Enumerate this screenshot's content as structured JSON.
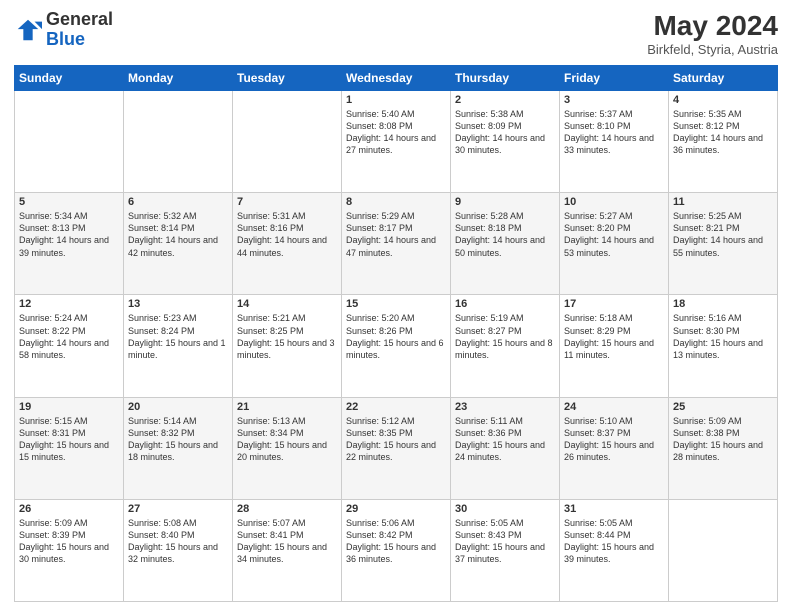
{
  "header": {
    "logo_general": "General",
    "logo_blue": "Blue",
    "month_year": "May 2024",
    "location": "Birkfeld, Styria, Austria"
  },
  "days_of_week": [
    "Sunday",
    "Monday",
    "Tuesday",
    "Wednesday",
    "Thursday",
    "Friday",
    "Saturday"
  ],
  "weeks": [
    [
      {
        "day": "",
        "sunrise": "",
        "sunset": "",
        "daylight": ""
      },
      {
        "day": "",
        "sunrise": "",
        "sunset": "",
        "daylight": ""
      },
      {
        "day": "",
        "sunrise": "",
        "sunset": "",
        "daylight": ""
      },
      {
        "day": "1",
        "sunrise": "Sunrise: 5:40 AM",
        "sunset": "Sunset: 8:08 PM",
        "daylight": "Daylight: 14 hours and 27 minutes."
      },
      {
        "day": "2",
        "sunrise": "Sunrise: 5:38 AM",
        "sunset": "Sunset: 8:09 PM",
        "daylight": "Daylight: 14 hours and 30 minutes."
      },
      {
        "day": "3",
        "sunrise": "Sunrise: 5:37 AM",
        "sunset": "Sunset: 8:10 PM",
        "daylight": "Daylight: 14 hours and 33 minutes."
      },
      {
        "day": "4",
        "sunrise": "Sunrise: 5:35 AM",
        "sunset": "Sunset: 8:12 PM",
        "daylight": "Daylight: 14 hours and 36 minutes."
      }
    ],
    [
      {
        "day": "5",
        "sunrise": "Sunrise: 5:34 AM",
        "sunset": "Sunset: 8:13 PM",
        "daylight": "Daylight: 14 hours and 39 minutes."
      },
      {
        "day": "6",
        "sunrise": "Sunrise: 5:32 AM",
        "sunset": "Sunset: 8:14 PM",
        "daylight": "Daylight: 14 hours and 42 minutes."
      },
      {
        "day": "7",
        "sunrise": "Sunrise: 5:31 AM",
        "sunset": "Sunset: 8:16 PM",
        "daylight": "Daylight: 14 hours and 44 minutes."
      },
      {
        "day": "8",
        "sunrise": "Sunrise: 5:29 AM",
        "sunset": "Sunset: 8:17 PM",
        "daylight": "Daylight: 14 hours and 47 minutes."
      },
      {
        "day": "9",
        "sunrise": "Sunrise: 5:28 AM",
        "sunset": "Sunset: 8:18 PM",
        "daylight": "Daylight: 14 hours and 50 minutes."
      },
      {
        "day": "10",
        "sunrise": "Sunrise: 5:27 AM",
        "sunset": "Sunset: 8:20 PM",
        "daylight": "Daylight: 14 hours and 53 minutes."
      },
      {
        "day": "11",
        "sunrise": "Sunrise: 5:25 AM",
        "sunset": "Sunset: 8:21 PM",
        "daylight": "Daylight: 14 hours and 55 minutes."
      }
    ],
    [
      {
        "day": "12",
        "sunrise": "Sunrise: 5:24 AM",
        "sunset": "Sunset: 8:22 PM",
        "daylight": "Daylight: 14 hours and 58 minutes."
      },
      {
        "day": "13",
        "sunrise": "Sunrise: 5:23 AM",
        "sunset": "Sunset: 8:24 PM",
        "daylight": "Daylight: 15 hours and 1 minute."
      },
      {
        "day": "14",
        "sunrise": "Sunrise: 5:21 AM",
        "sunset": "Sunset: 8:25 PM",
        "daylight": "Daylight: 15 hours and 3 minutes."
      },
      {
        "day": "15",
        "sunrise": "Sunrise: 5:20 AM",
        "sunset": "Sunset: 8:26 PM",
        "daylight": "Daylight: 15 hours and 6 minutes."
      },
      {
        "day": "16",
        "sunrise": "Sunrise: 5:19 AM",
        "sunset": "Sunset: 8:27 PM",
        "daylight": "Daylight: 15 hours and 8 minutes."
      },
      {
        "day": "17",
        "sunrise": "Sunrise: 5:18 AM",
        "sunset": "Sunset: 8:29 PM",
        "daylight": "Daylight: 15 hours and 11 minutes."
      },
      {
        "day": "18",
        "sunrise": "Sunrise: 5:16 AM",
        "sunset": "Sunset: 8:30 PM",
        "daylight": "Daylight: 15 hours and 13 minutes."
      }
    ],
    [
      {
        "day": "19",
        "sunrise": "Sunrise: 5:15 AM",
        "sunset": "Sunset: 8:31 PM",
        "daylight": "Daylight: 15 hours and 15 minutes."
      },
      {
        "day": "20",
        "sunrise": "Sunrise: 5:14 AM",
        "sunset": "Sunset: 8:32 PM",
        "daylight": "Daylight: 15 hours and 18 minutes."
      },
      {
        "day": "21",
        "sunrise": "Sunrise: 5:13 AM",
        "sunset": "Sunset: 8:34 PM",
        "daylight": "Daylight: 15 hours and 20 minutes."
      },
      {
        "day": "22",
        "sunrise": "Sunrise: 5:12 AM",
        "sunset": "Sunset: 8:35 PM",
        "daylight": "Daylight: 15 hours and 22 minutes."
      },
      {
        "day": "23",
        "sunrise": "Sunrise: 5:11 AM",
        "sunset": "Sunset: 8:36 PM",
        "daylight": "Daylight: 15 hours and 24 minutes."
      },
      {
        "day": "24",
        "sunrise": "Sunrise: 5:10 AM",
        "sunset": "Sunset: 8:37 PM",
        "daylight": "Daylight: 15 hours and 26 minutes."
      },
      {
        "day": "25",
        "sunrise": "Sunrise: 5:09 AM",
        "sunset": "Sunset: 8:38 PM",
        "daylight": "Daylight: 15 hours and 28 minutes."
      }
    ],
    [
      {
        "day": "26",
        "sunrise": "Sunrise: 5:09 AM",
        "sunset": "Sunset: 8:39 PM",
        "daylight": "Daylight: 15 hours and 30 minutes."
      },
      {
        "day": "27",
        "sunrise": "Sunrise: 5:08 AM",
        "sunset": "Sunset: 8:40 PM",
        "daylight": "Daylight: 15 hours and 32 minutes."
      },
      {
        "day": "28",
        "sunrise": "Sunrise: 5:07 AM",
        "sunset": "Sunset: 8:41 PM",
        "daylight": "Daylight: 15 hours and 34 minutes."
      },
      {
        "day": "29",
        "sunrise": "Sunrise: 5:06 AM",
        "sunset": "Sunset: 8:42 PM",
        "daylight": "Daylight: 15 hours and 36 minutes."
      },
      {
        "day": "30",
        "sunrise": "Sunrise: 5:05 AM",
        "sunset": "Sunset: 8:43 PM",
        "daylight": "Daylight: 15 hours and 37 minutes."
      },
      {
        "day": "31",
        "sunrise": "Sunrise: 5:05 AM",
        "sunset": "Sunset: 8:44 PM",
        "daylight": "Daylight: 15 hours and 39 minutes."
      },
      {
        "day": "",
        "sunrise": "",
        "sunset": "",
        "daylight": ""
      }
    ]
  ]
}
